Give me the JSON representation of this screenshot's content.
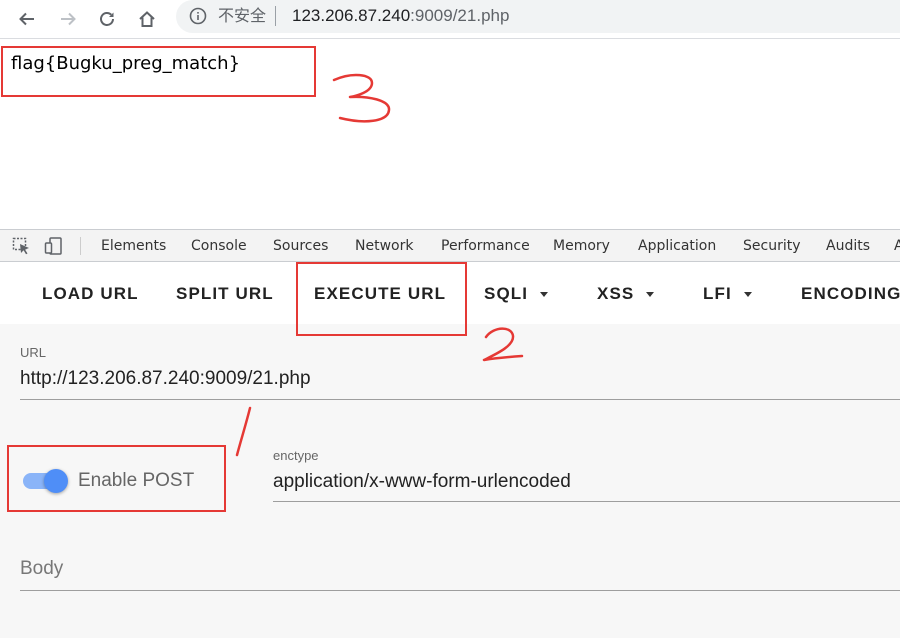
{
  "browser": {
    "security_label": "不安全",
    "url_host": "123.206.87.240",
    "url_rest": ":9009/21.php"
  },
  "page": {
    "flag_text": "flag{Bugku_preg_match}"
  },
  "devtools": {
    "tabs": [
      "Elements",
      "Console",
      "Sources",
      "Network",
      "Performance",
      "Memory",
      "Application",
      "Security",
      "Audits",
      "A"
    ]
  },
  "hackbar": {
    "menu": [
      {
        "label": "LOAD URL",
        "dropdown": false
      },
      {
        "label": "SPLIT URL",
        "dropdown": false
      },
      {
        "label": "EXECUTE URL",
        "dropdown": false
      },
      {
        "label": "SQLI",
        "dropdown": true
      },
      {
        "label": "XSS",
        "dropdown": true
      },
      {
        "label": "LFI",
        "dropdown": true
      },
      {
        "label": "ENCODING",
        "dropdown": false
      }
    ],
    "url_label": "URL",
    "url_value": "http://123.206.87.240:9009/21.php",
    "enable_post_label": "Enable POST",
    "enable_post": true,
    "enctype_label": "enctype",
    "enctype_value": "application/x-www-form-urlencoded",
    "body_placeholder": "Body"
  },
  "colors": {
    "annotation": "#e53935",
    "toggle_accent": "#4f8ef7"
  }
}
